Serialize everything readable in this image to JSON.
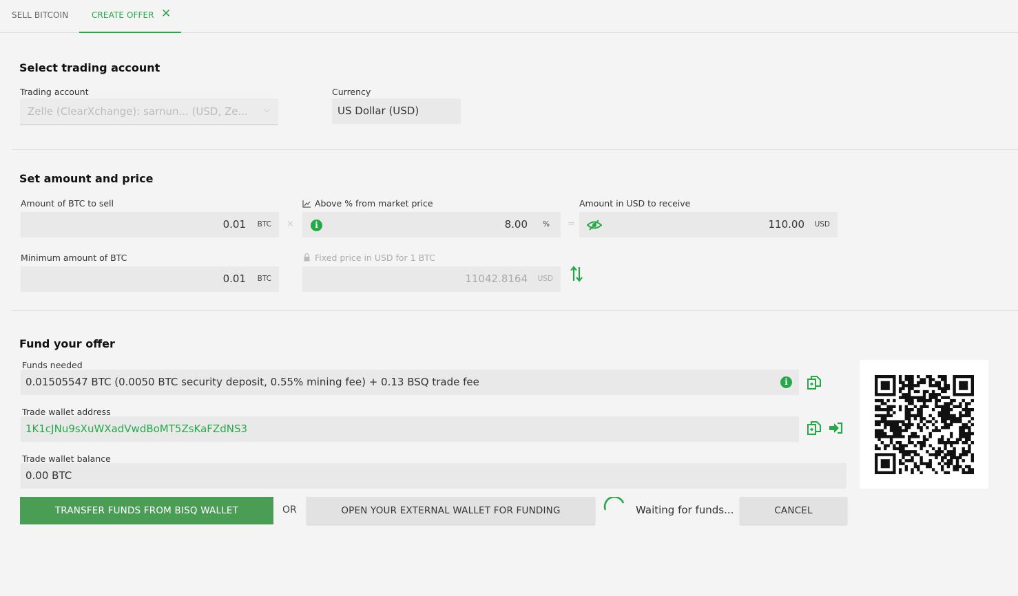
{
  "tabs": [
    {
      "label": "SELL BITCOIN",
      "active": false
    },
    {
      "label": "CREATE OFFER",
      "active": true
    }
  ],
  "account_section": {
    "title": "Select trading account",
    "trading_account_label": "Trading account",
    "trading_account_value": "Zelle (ClearXchange): sarnun... (USD, Ze...",
    "currency_label": "Currency",
    "currency_value": "US Dollar (USD)"
  },
  "amount_section": {
    "title": "Set amount and price",
    "amount_label": "Amount of BTC to sell",
    "amount_value": "0.01",
    "amount_unit": "BTC",
    "multiply_symbol": "×",
    "percent_label": "Above % from market price",
    "percent_value": "8.00",
    "percent_unit": "%",
    "equals_symbol": "=",
    "receive_label": "Amount in USD to receive",
    "receive_value": "110.00",
    "receive_unit": "USD",
    "min_amount_label": "Minimum amount of BTC",
    "min_amount_value": "0.01",
    "min_amount_unit": "BTC",
    "fixed_price_label": "Fixed price in USD for 1 BTC",
    "fixed_price_value": "11042.8164",
    "fixed_price_unit": "USD"
  },
  "fund_section": {
    "title": "Fund your offer",
    "funds_needed_label": "Funds needed",
    "funds_needed_value": "0.01505547 BTC (0.0050 BTC security deposit, 0.55% mining fee) + 0.13 BSQ trade fee",
    "wallet_address_label": "Trade wallet address",
    "wallet_address_value": "1K1cJNu9sXuWXadVwdBoMT5ZsKaFZdNS3",
    "wallet_balance_label": "Trade wallet balance",
    "wallet_balance_value": "0.00 BTC",
    "transfer_button": "TRANSFER FUNDS FROM BISQ WALLET",
    "or_label": "OR",
    "external_wallet_button": "OPEN YOUR EXTERNAL WALLET FOR FUNDING",
    "waiting_text": "Waiting for funds...",
    "cancel_button": "CANCEL"
  },
  "colors": {
    "accent": "#25a848",
    "button_primary": "#4a9d55",
    "field_bg": "#e9e9e9"
  },
  "icons": [
    "close-icon",
    "chevron-down-icon",
    "chart-icon",
    "info-icon",
    "eye-slash-icon",
    "lock-icon",
    "swap-arrows-icon",
    "copy-icon",
    "open-wallet-icon",
    "spinner-icon",
    "qr-code"
  ]
}
